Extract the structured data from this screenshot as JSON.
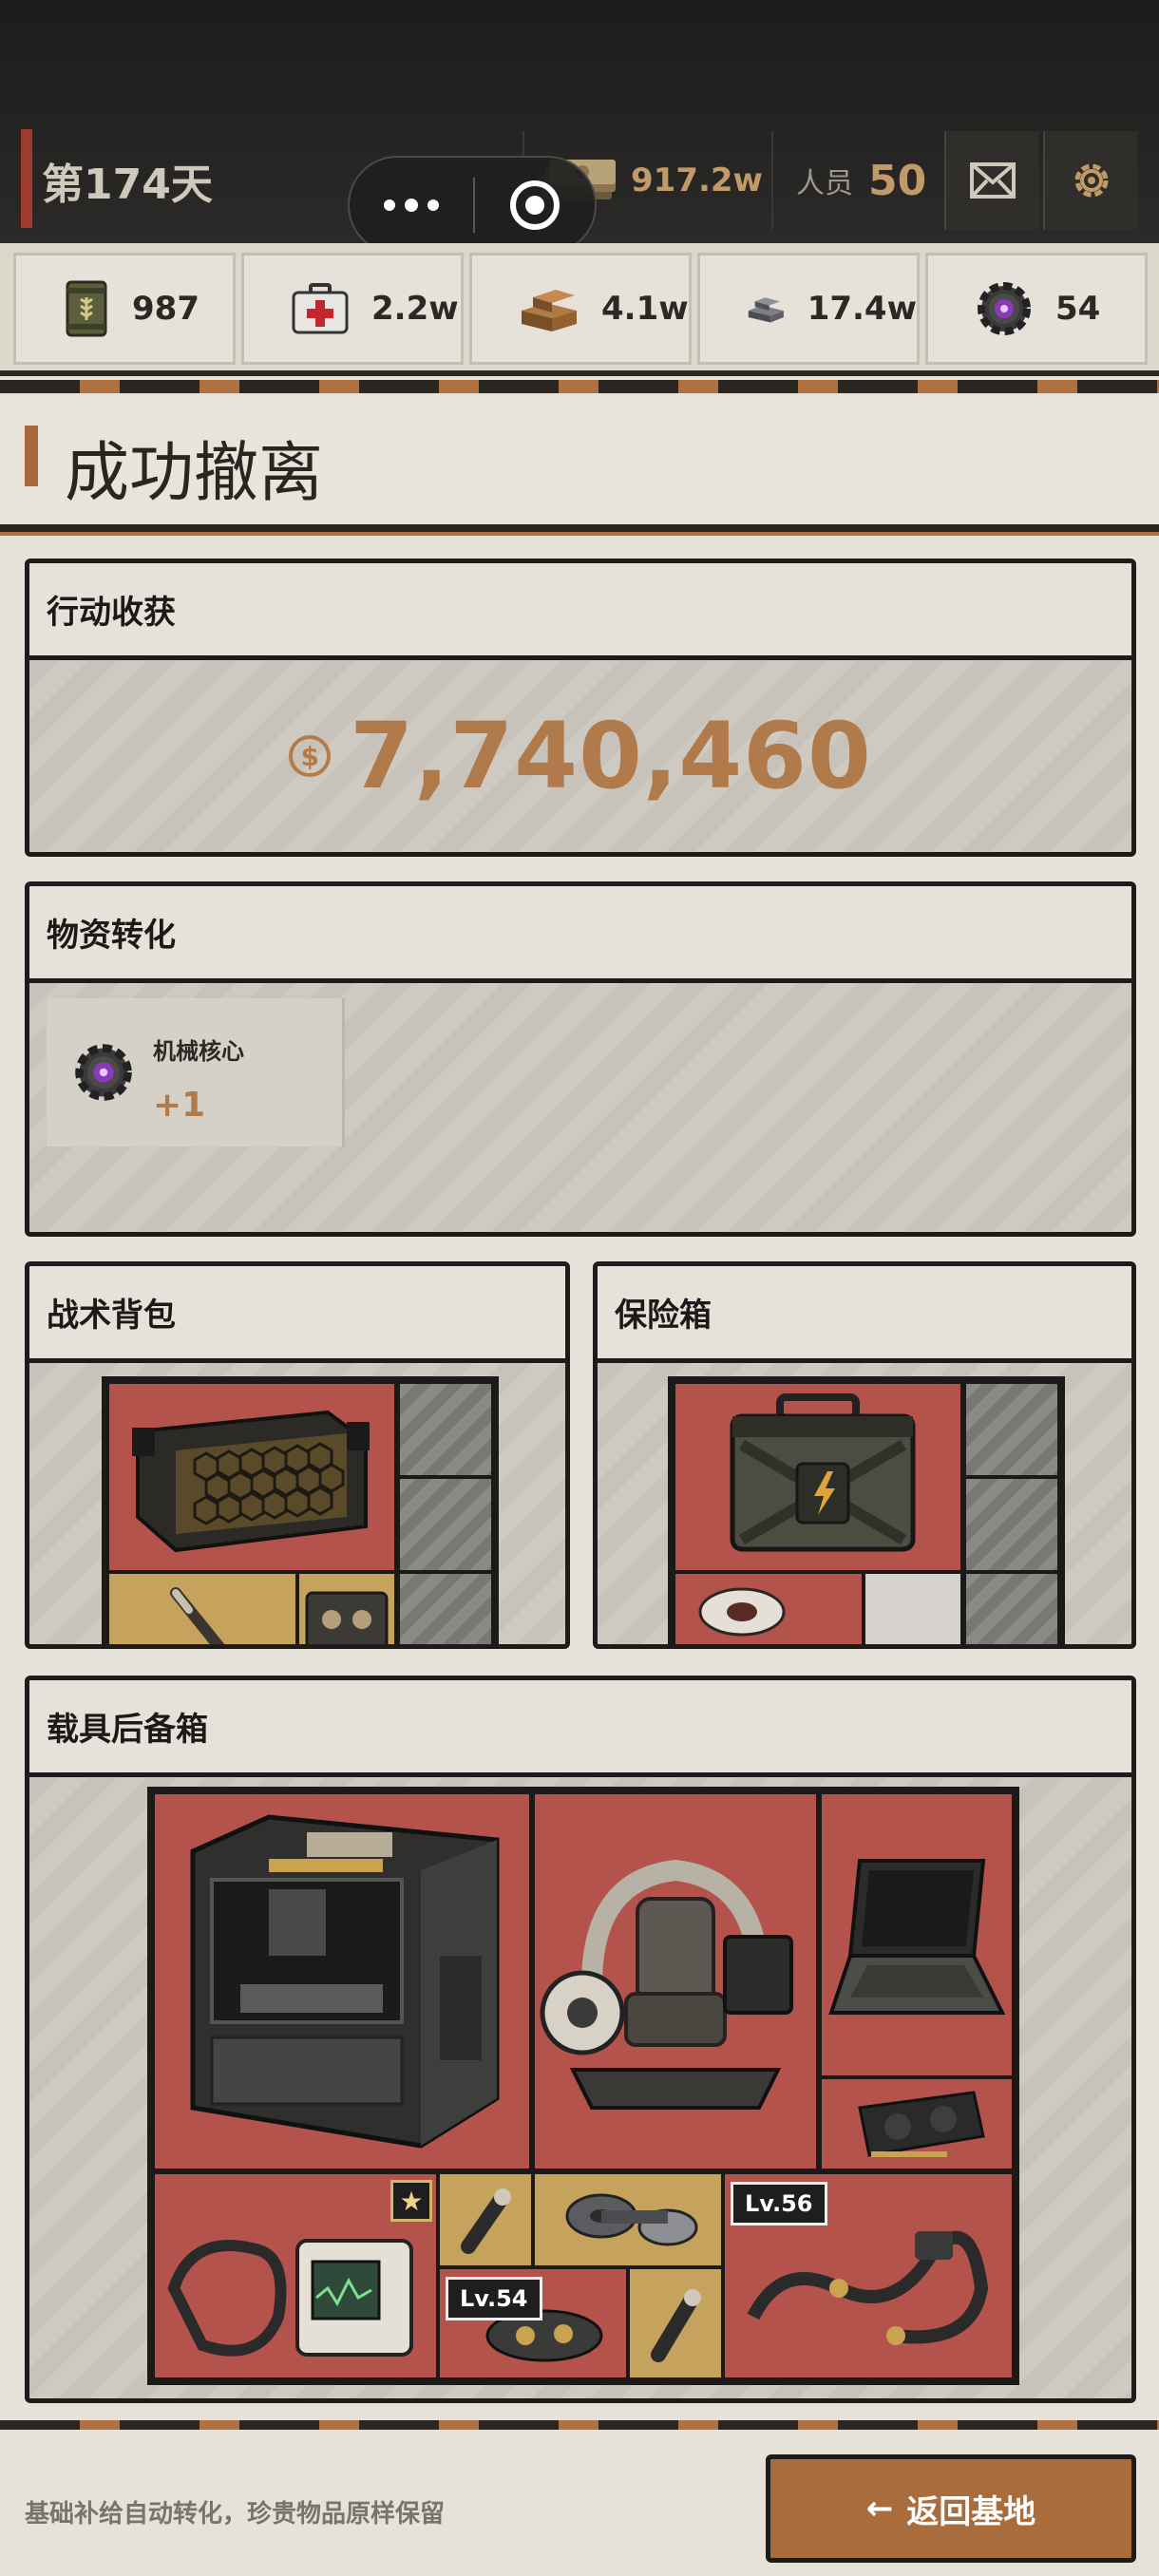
{
  "header": {
    "day_label": "第174天",
    "money": "917.2w",
    "people_label": "人员",
    "people_count": "50"
  },
  "resources": [
    {
      "icon": "grain-can-icon",
      "value": "987"
    },
    {
      "icon": "medkit-icon",
      "value": "2.2w"
    },
    {
      "icon": "wood-planks-icon",
      "value": "4.1w"
    },
    {
      "icon": "metal-ingots-icon",
      "value": "17.4w"
    },
    {
      "icon": "mech-core-icon",
      "value": "54"
    }
  ],
  "page_title": "成功撤离",
  "harvest": {
    "title": "行动收获",
    "currency_symbol": "$",
    "value": "7,740,460"
  },
  "conversion": {
    "title": "物资转化",
    "items": [
      {
        "name": "机械核心",
        "count": "+1",
        "icon": "mech-core-icon"
      }
    ]
  },
  "backpack": {
    "title": "战术背包"
  },
  "safebox": {
    "title": "保险箱"
  },
  "trunk": {
    "title": "载具后备箱",
    "level_tags": [
      "Lv.56",
      "Lv.54"
    ],
    "star": "★"
  },
  "footer": {
    "tip": "基础补给自动转化，珍贵物品原样保留",
    "return_arrow": "←",
    "return_label": "返回基地"
  },
  "colors": {
    "accent": "#a86c3d",
    "gold_text": "#b07a4a",
    "slot_red": "#b3534c",
    "slot_yellow": "#c6a35c",
    "day_accent": "#a03a2c"
  }
}
